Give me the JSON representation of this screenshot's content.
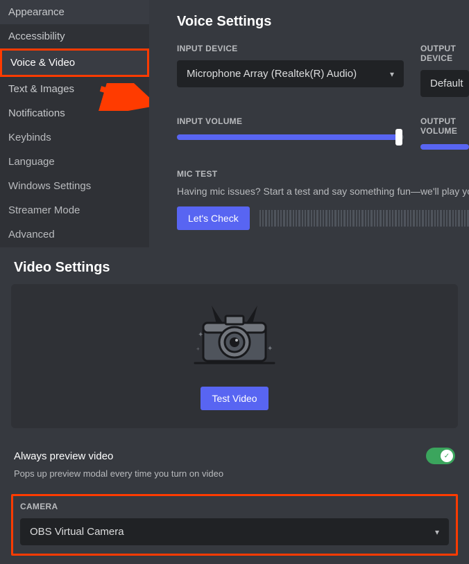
{
  "sidebar": {
    "items": [
      {
        "label": "Appearance"
      },
      {
        "label": "Accessibility"
      },
      {
        "label": "Voice & Video",
        "highlighted": true
      },
      {
        "label": "Text & Images"
      },
      {
        "label": "Notifications"
      },
      {
        "label": "Keybinds"
      },
      {
        "label": "Language"
      },
      {
        "label": "Windows Settings"
      },
      {
        "label": "Streamer Mode"
      },
      {
        "label": "Advanced"
      }
    ]
  },
  "voice": {
    "title": "Voice Settings",
    "input_label": "INPUT DEVICE",
    "input_value": "Microphone Array (Realtek(R) Audio)",
    "output_label": "OUTPUT DEVICE",
    "output_value": "Default",
    "input_volume_label": "INPUT VOLUME",
    "input_volume_percent": 98,
    "output_volume_label": "OUTPUT VOLUME",
    "output_volume_percent": 100,
    "mic_test_label": "MIC TEST",
    "mic_test_desc": "Having mic issues? Start a test and say something fun—we'll play your voice back to you.",
    "mic_test_button": "Let's Check"
  },
  "video": {
    "title": "Video Settings",
    "test_button": "Test Video",
    "always_preview_label": "Always preview video",
    "always_preview_desc": "Pops up preview modal every time you turn on video",
    "always_preview_on": true,
    "camera_label": "CAMERA",
    "camera_value": "OBS Virtual Camera"
  }
}
